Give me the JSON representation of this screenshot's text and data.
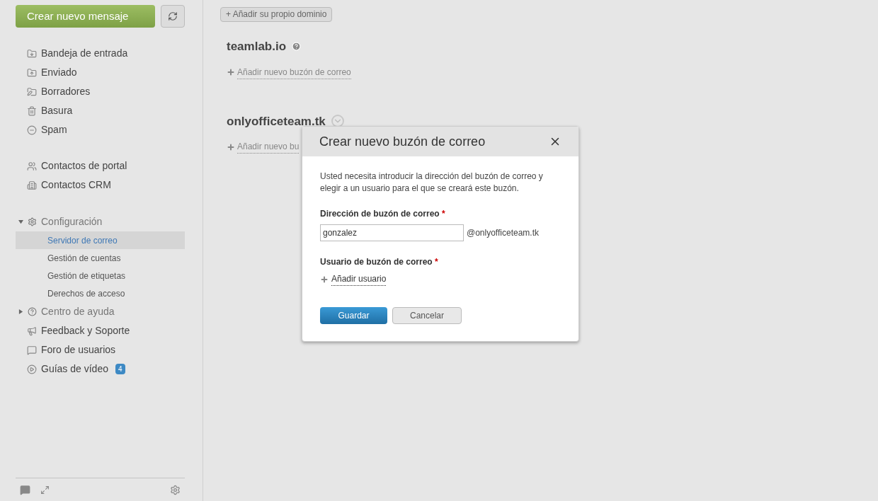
{
  "sidebar": {
    "compose_button": "Crear nuevo mensaje",
    "folders": [
      {
        "label": "Bandeja de entrada",
        "kind": "inbox"
      },
      {
        "label": "Enviado",
        "kind": "sent"
      },
      {
        "label": "Borradores",
        "kind": "drafts"
      },
      {
        "label": "Basura",
        "kind": "trash"
      },
      {
        "label": "Spam",
        "kind": "spam"
      }
    ],
    "contacts": [
      {
        "label": "Contactos de portal",
        "kind": "people"
      },
      {
        "label": "Contactos CRM",
        "kind": "crm"
      }
    ],
    "sections": [
      {
        "label": "Configuración",
        "kind": "settings",
        "expanded": true,
        "children": [
          {
            "label": "Servidor de correo",
            "selected": true
          },
          {
            "label": "Gestión de cuentas",
            "selected": false
          },
          {
            "label": "Gestión de etiquetas",
            "selected": false
          },
          {
            "label": "Derechos de acceso",
            "selected": false
          }
        ]
      },
      {
        "label": "Centro de ayuda",
        "kind": "help",
        "expanded": false
      }
    ],
    "links": [
      {
        "label": "Feedback y Soporte",
        "kind": "megaphone"
      },
      {
        "label": "Foro de usuarios",
        "kind": "chat"
      },
      {
        "label": "Guías de vídeo",
        "kind": "video",
        "badge": "4"
      }
    ]
  },
  "main": {
    "add_domain_button": "+ Añadir su propio dominio",
    "domains": [
      {
        "name": "teamlab.io",
        "kind": "help",
        "add_link": "Añadir nuevo buzón de correo"
      },
      {
        "name": "onlyofficeteam.tk",
        "kind": "menu",
        "add_link": "Añadir nuevo bu"
      }
    ]
  },
  "dialog": {
    "title": "Crear nuevo buzón de correo",
    "description": "Usted necesita introducir la dirección del buzón de correo y elegir a un usuario para el que se creará este buzón.",
    "address_label": "Dirección de buzón de correo",
    "address_required": "*",
    "address_value": "gonzalez",
    "address_suffix": "@onlyofficeteam.tk",
    "user_label": "Usuario de buzón de correo",
    "user_required": "*",
    "add_user_link": "Añadir usuario",
    "buttons": [
      {
        "label": "Guardar",
        "kind": "primary"
      },
      {
        "label": "Cancelar",
        "kind": "secondary"
      }
    ]
  }
}
